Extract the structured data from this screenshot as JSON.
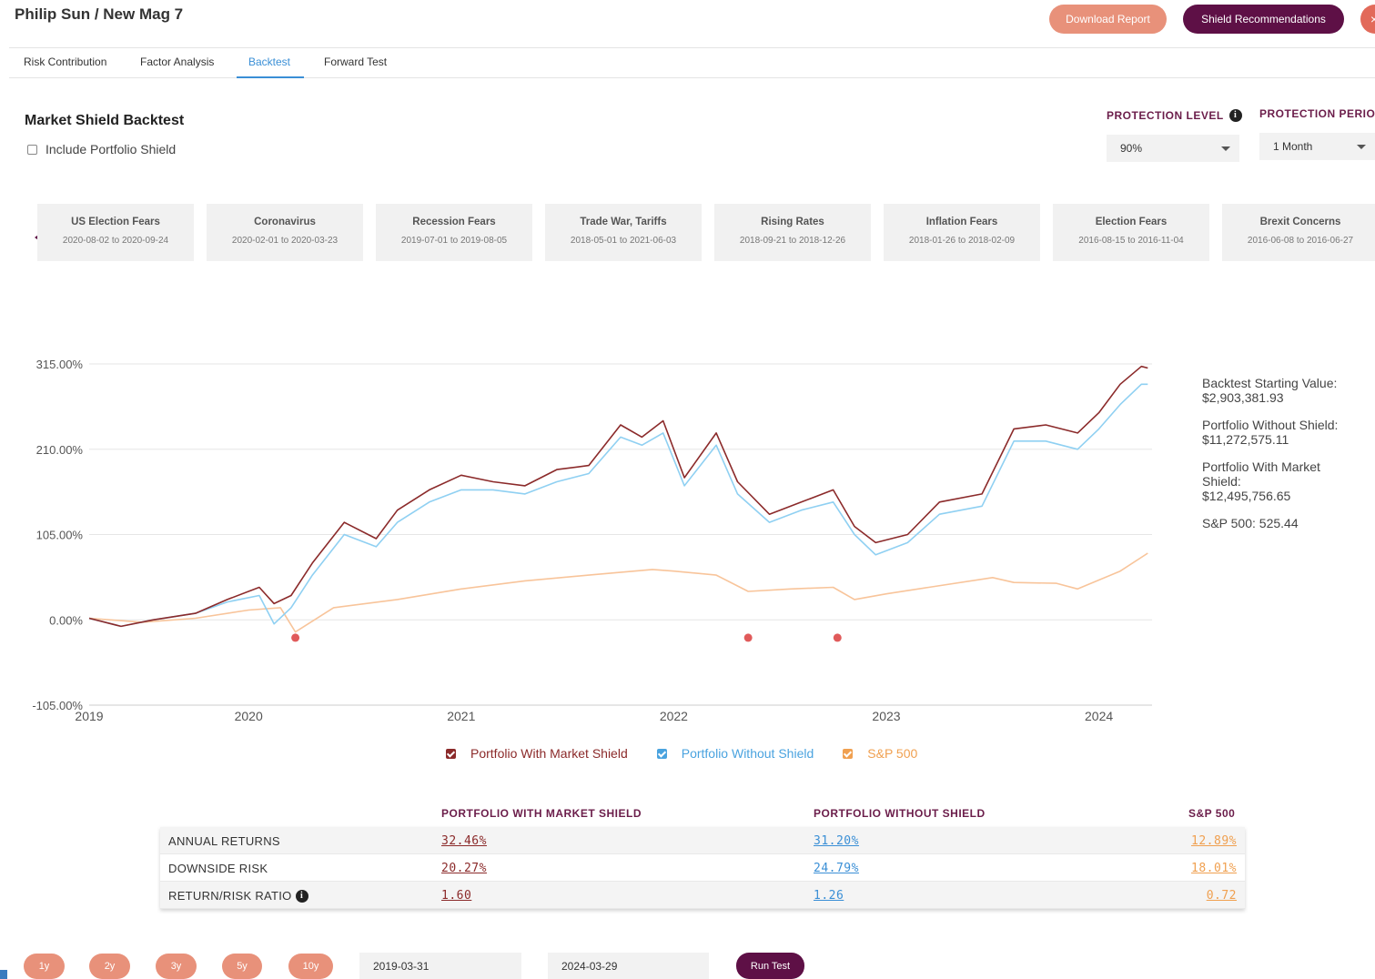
{
  "header": {
    "title": "Philip Sun / New Mag 7",
    "download_label": "Download Report",
    "shield_label": "Shield Recommendations",
    "close_label": "×"
  },
  "tabs": [
    {
      "label": "Risk Contribution"
    },
    {
      "label": "Factor Analysis"
    },
    {
      "label": "Backtest"
    },
    {
      "label": "Forward Test"
    }
  ],
  "active_tab": "Backtest",
  "section": {
    "title": "Market Shield Backtest",
    "include_label": "Include Portfolio Shield",
    "include_checked": false
  },
  "controls": {
    "protection_level_label": "PROTECTION LEVEL",
    "protection_level_value": "90%",
    "protection_period_label": "PROTECTION PERIOD",
    "protection_period_value": "1 Month"
  },
  "scenarios": [
    {
      "title": "US Election Fears",
      "range": "2020-08-02 to 2020-09-24"
    },
    {
      "title": "Coronavirus",
      "range": "2020-02-01 to 2020-03-23"
    },
    {
      "title": "Recession Fears",
      "range": "2019-07-01 to 2019-08-05"
    },
    {
      "title": "Trade War, Tariffs",
      "range": "2018-05-01 to 2021-06-03"
    },
    {
      "title": "Rising Rates",
      "range": "2018-09-21 to 2018-12-26"
    },
    {
      "title": "Inflation Fears",
      "range": "2018-01-26 to 2018-02-09"
    },
    {
      "title": "Election Fears",
      "range": "2016-08-15 to 2016-11-04"
    },
    {
      "title": "Brexit Concerns",
      "range": "2016-06-08 to 2016-06-27"
    }
  ],
  "stats": {
    "starting_label": "Backtest Starting Value:",
    "starting_value": "$2,903,381.93",
    "without_label": "Portfolio Without Shield:",
    "without_value": "$11,272,575.11",
    "with_label": "Portfolio With Market Shield:",
    "with_value": "$12,495,756.65",
    "sp_text": "S&P 500: 525.44"
  },
  "legend": [
    {
      "label": "Portfolio With Market Shield",
      "color": "#8b2a2a"
    },
    {
      "label": "Portfolio Without Shield",
      "color": "#4aa3df"
    },
    {
      "label": "S&P 500",
      "color": "#f0a050"
    }
  ],
  "table": {
    "headers": [
      "PORTFOLIO WITH MARKET SHIELD",
      "PORTFOLIO WITHOUT SHIELD",
      "S&P 500"
    ],
    "rows": [
      {
        "label": "ANNUAL RETURNS",
        "values": [
          "32.46%",
          "31.20%",
          "12.89%"
        ]
      },
      {
        "label": "DOWNSIDE RISK",
        "values": [
          "20.27%",
          "24.79%",
          "18.01%"
        ]
      },
      {
        "label": "RETURN/RISK RATIO",
        "values": [
          "1.60",
          "1.26",
          "0.72"
        ]
      }
    ]
  },
  "periods": [
    "1y",
    "2y",
    "3y",
    "5y",
    "10y"
  ],
  "dates": {
    "start": "2019-03-31",
    "end": "2024-03-29"
  },
  "run_label": "Run Test",
  "colors": {
    "with_shield": "#8b2a2a",
    "without_shield": "#8fd0f2",
    "sp500": "#f8c49a",
    "accent": "#5e1046",
    "salmon": "#e8917a",
    "link_blue": "#3a8fd6",
    "marker": "#e05a5a"
  },
  "chart_data": {
    "type": "line",
    "y_tick_labels": [
      "315.00%",
      "210.00%",
      "105.00%",
      "0.00%",
      "-105.00%"
    ],
    "y_ticks": [
      315,
      210,
      105,
      0,
      -105
    ],
    "ylim": [
      -105,
      315
    ],
    "x_tick_labels": [
      "2019",
      "2020",
      "2021",
      "2022",
      "2023",
      "2024"
    ],
    "x_ticks": [
      2019.25,
      2020,
      2021,
      2022,
      2023,
      2024
    ],
    "xlim": [
      2019.25,
      2024.25
    ],
    "series": [
      {
        "name": "Portfolio With Market Shield",
        "x": [
          2019.25,
          2019.4,
          2019.55,
          2019.75,
          2019.9,
          2020.05,
          2020.12,
          2020.2,
          2020.3,
          2020.45,
          2020.6,
          2020.7,
          2020.85,
          2021.0,
          2021.15,
          2021.3,
          2021.45,
          2021.6,
          2021.75,
          2021.85,
          2021.95,
          2022.05,
          2022.2,
          2022.3,
          2022.45,
          2022.6,
          2022.75,
          2022.85,
          2022.95,
          2023.1,
          2023.25,
          2023.45,
          2023.6,
          2023.75,
          2023.9,
          2024.0,
          2024.1,
          2024.2,
          2024.23
        ],
        "values": [
          2,
          -8,
          0,
          8,
          25,
          40,
          20,
          30,
          70,
          120,
          100,
          135,
          160,
          178,
          170,
          165,
          185,
          190,
          240,
          225,
          245,
          175,
          230,
          170,
          130,
          145,
          160,
          115,
          95,
          105,
          145,
          155,
          235,
          240,
          230,
          255,
          290,
          312,
          310
        ]
      },
      {
        "name": "Portfolio Without Shield",
        "x": [
          2019.25,
          2019.4,
          2019.55,
          2019.75,
          2019.9,
          2020.05,
          2020.12,
          2020.2,
          2020.3,
          2020.45,
          2020.6,
          2020.7,
          2020.85,
          2021.0,
          2021.15,
          2021.3,
          2021.45,
          2021.6,
          2021.75,
          2021.85,
          2021.95,
          2022.05,
          2022.2,
          2022.3,
          2022.45,
          2022.6,
          2022.75,
          2022.85,
          2022.95,
          2023.1,
          2023.25,
          2023.45,
          2023.6,
          2023.75,
          2023.9,
          2024.0,
          2024.1,
          2024.2,
          2024.23
        ],
        "values": [
          2,
          -8,
          0,
          8,
          22,
          30,
          -5,
          15,
          55,
          105,
          90,
          120,
          145,
          160,
          160,
          155,
          170,
          180,
          225,
          215,
          230,
          165,
          215,
          155,
          120,
          135,
          145,
          105,
          80,
          95,
          130,
          140,
          220,
          220,
          210,
          235,
          265,
          290,
          290
        ]
      },
      {
        "name": "S&P 500",
        "x": [
          2019.25,
          2019.5,
          2019.75,
          2020.0,
          2020.15,
          2020.22,
          2020.4,
          2020.7,
          2021.0,
          2021.3,
          2021.6,
          2021.9,
          2022.0,
          2022.2,
          2022.35,
          2022.55,
          2022.75,
          2022.85,
          2023.0,
          2023.2,
          2023.5,
          2023.6,
          2023.8,
          2023.9,
          2024.1,
          2024.23
        ],
        "values": [
          2,
          -3,
          2,
          12,
          15,
          -15,
          15,
          25,
          38,
          48,
          55,
          62,
          60,
          55,
          35,
          38,
          40,
          25,
          32,
          40,
          52,
          46,
          45,
          38,
          60,
          82
        ]
      }
    ],
    "markers": {
      "x": [
        2020.22,
        2022.35,
        2022.77
      ],
      "y": -22
    }
  }
}
